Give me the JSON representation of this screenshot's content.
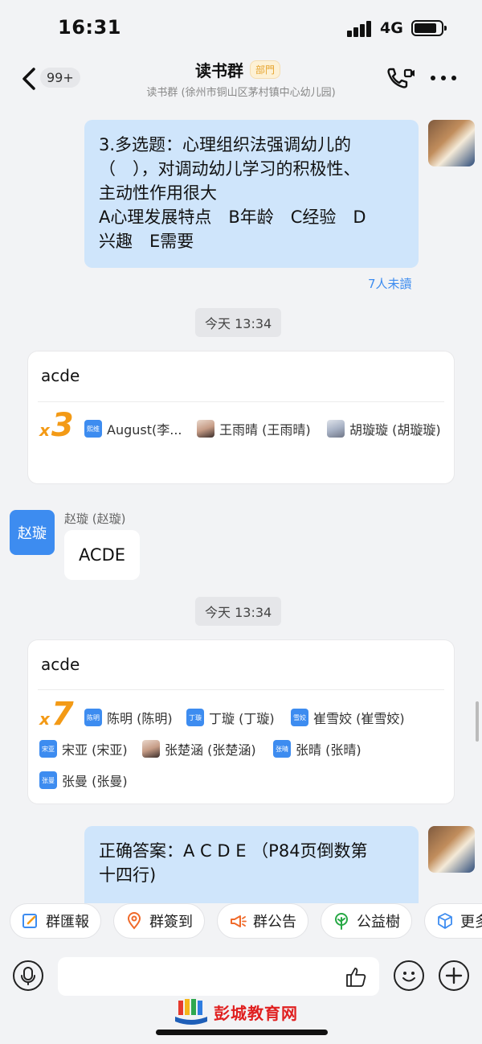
{
  "status_bar": {
    "time": "16:31",
    "network": "4G"
  },
  "nav": {
    "back_badge": "99+",
    "title": "读书群",
    "tag": "部門",
    "subtitle": "读书群 (徐州市铜山区茅村镇中心幼儿园)"
  },
  "messages": {
    "question": {
      "lines": [
        "3.多选题：心理组织法强调幼儿的",
        "（　），对调动幼儿学习的积极性、",
        "主动性作用很大",
        "A心理发展特点　B年龄　C经验　D",
        "兴趣　E需要"
      ],
      "read_status": "7人未讀"
    },
    "time1": "今天 13:34",
    "card1": {
      "title": "acde",
      "count_prefix": "x",
      "count": "3",
      "voters": [
        {
          "avatar": "熙维",
          "name": "August(李..."
        },
        {
          "avatar": "",
          "name": "王雨晴 (王雨晴)"
        },
        {
          "avatar": "",
          "name": "胡璇璇 (胡璇璇)"
        }
      ]
    },
    "sender": {
      "avatar_text": "赵璇",
      "name": "赵璇 (赵璇)",
      "message": "ACDE"
    },
    "time2": "今天 13:34",
    "card2": {
      "title": "acde",
      "count_prefix": "x",
      "count": "7",
      "voters": [
        {
          "avatar": "陈明",
          "name": "陈明 (陈明)"
        },
        {
          "avatar": "丁璇",
          "name": "丁璇 (丁璇)"
        },
        {
          "avatar": "雪姣",
          "name": "崔雪姣 (崔雪姣)"
        },
        {
          "avatar": "宋亚",
          "name": "宋亚 (宋亚)"
        },
        {
          "avatar": "",
          "name": "张楚涵 (张楚涵)"
        },
        {
          "avatar": "张晴",
          "name": "张晴 (张晴)"
        },
        {
          "avatar": "张曼",
          "name": "张曼 (张曼)"
        }
      ]
    },
    "answer": {
      "lines": [
        "正确答案：A C D E （P84页倒数第",
        "十四行)"
      ]
    }
  },
  "quick_actions": [
    {
      "label": "群匯報",
      "icon": "report-icon"
    },
    {
      "label": "群簽到",
      "icon": "location-pin-icon"
    },
    {
      "label": "群公告",
      "icon": "megaphone-icon"
    },
    {
      "label": "公益樹",
      "icon": "tree-icon"
    },
    {
      "label": "更多",
      "icon": "cube-icon"
    }
  ],
  "input": {
    "placeholder": ""
  },
  "watermark": "彭城教育网",
  "colors": {
    "accent": "#3d8cf0",
    "bubble": "#cfe5fb",
    "count": "#f39a16",
    "tag": "#e6a530"
  }
}
